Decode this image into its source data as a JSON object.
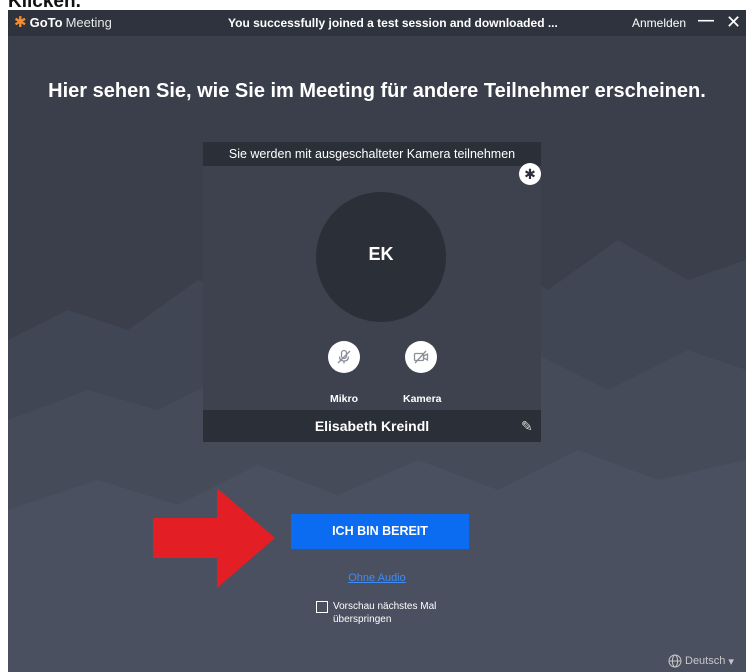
{
  "cropped_caption": "Klicken.",
  "app": {
    "logo_goto": "GoTo",
    "logo_meeting": "Meeting",
    "title": "You successfully joined a test session and downloaded ...",
    "login_label": "Anmelden",
    "minimize_glyph": "—",
    "close_glyph": "✕"
  },
  "main": {
    "heading": "Hier sehen Sie, wie Sie im Meeting für andere Teilnehmer erscheinen."
  },
  "preview": {
    "status": "Sie werden mit ausgeschalteter Kamera teilnehmen",
    "initials": "EK",
    "mic_label": "Mikro",
    "camera_label": "Kamera",
    "name": "Elisabeth Kreindl",
    "gear_glyph": "✱",
    "pencil_glyph": "✎"
  },
  "actions": {
    "ready_label": "ICH BIN BEREIT",
    "no_audio_label": "Ohne Audio",
    "skip_preview_label": "Vorschau nächstes Mal überspringen",
    "skip_preview_checked": false
  },
  "footer": {
    "language": "Deutsch",
    "language_caret": "▾"
  },
  "colors": {
    "background": "#3a3f4b",
    "panel": "#2b2f38",
    "accent_button": "#0b6cf1",
    "link": "#3e8cf5",
    "annotation_arrow": "#e31e24",
    "logo": "#f68d2e"
  },
  "icons": {
    "logo": "goto-logo-icon",
    "settings": "gear-icon",
    "mic": "mic-muted-icon",
    "camera": "camera-off-icon",
    "edit": "pencil-icon",
    "language": "globe-icon",
    "annotation": "red-arrow-annotation"
  }
}
